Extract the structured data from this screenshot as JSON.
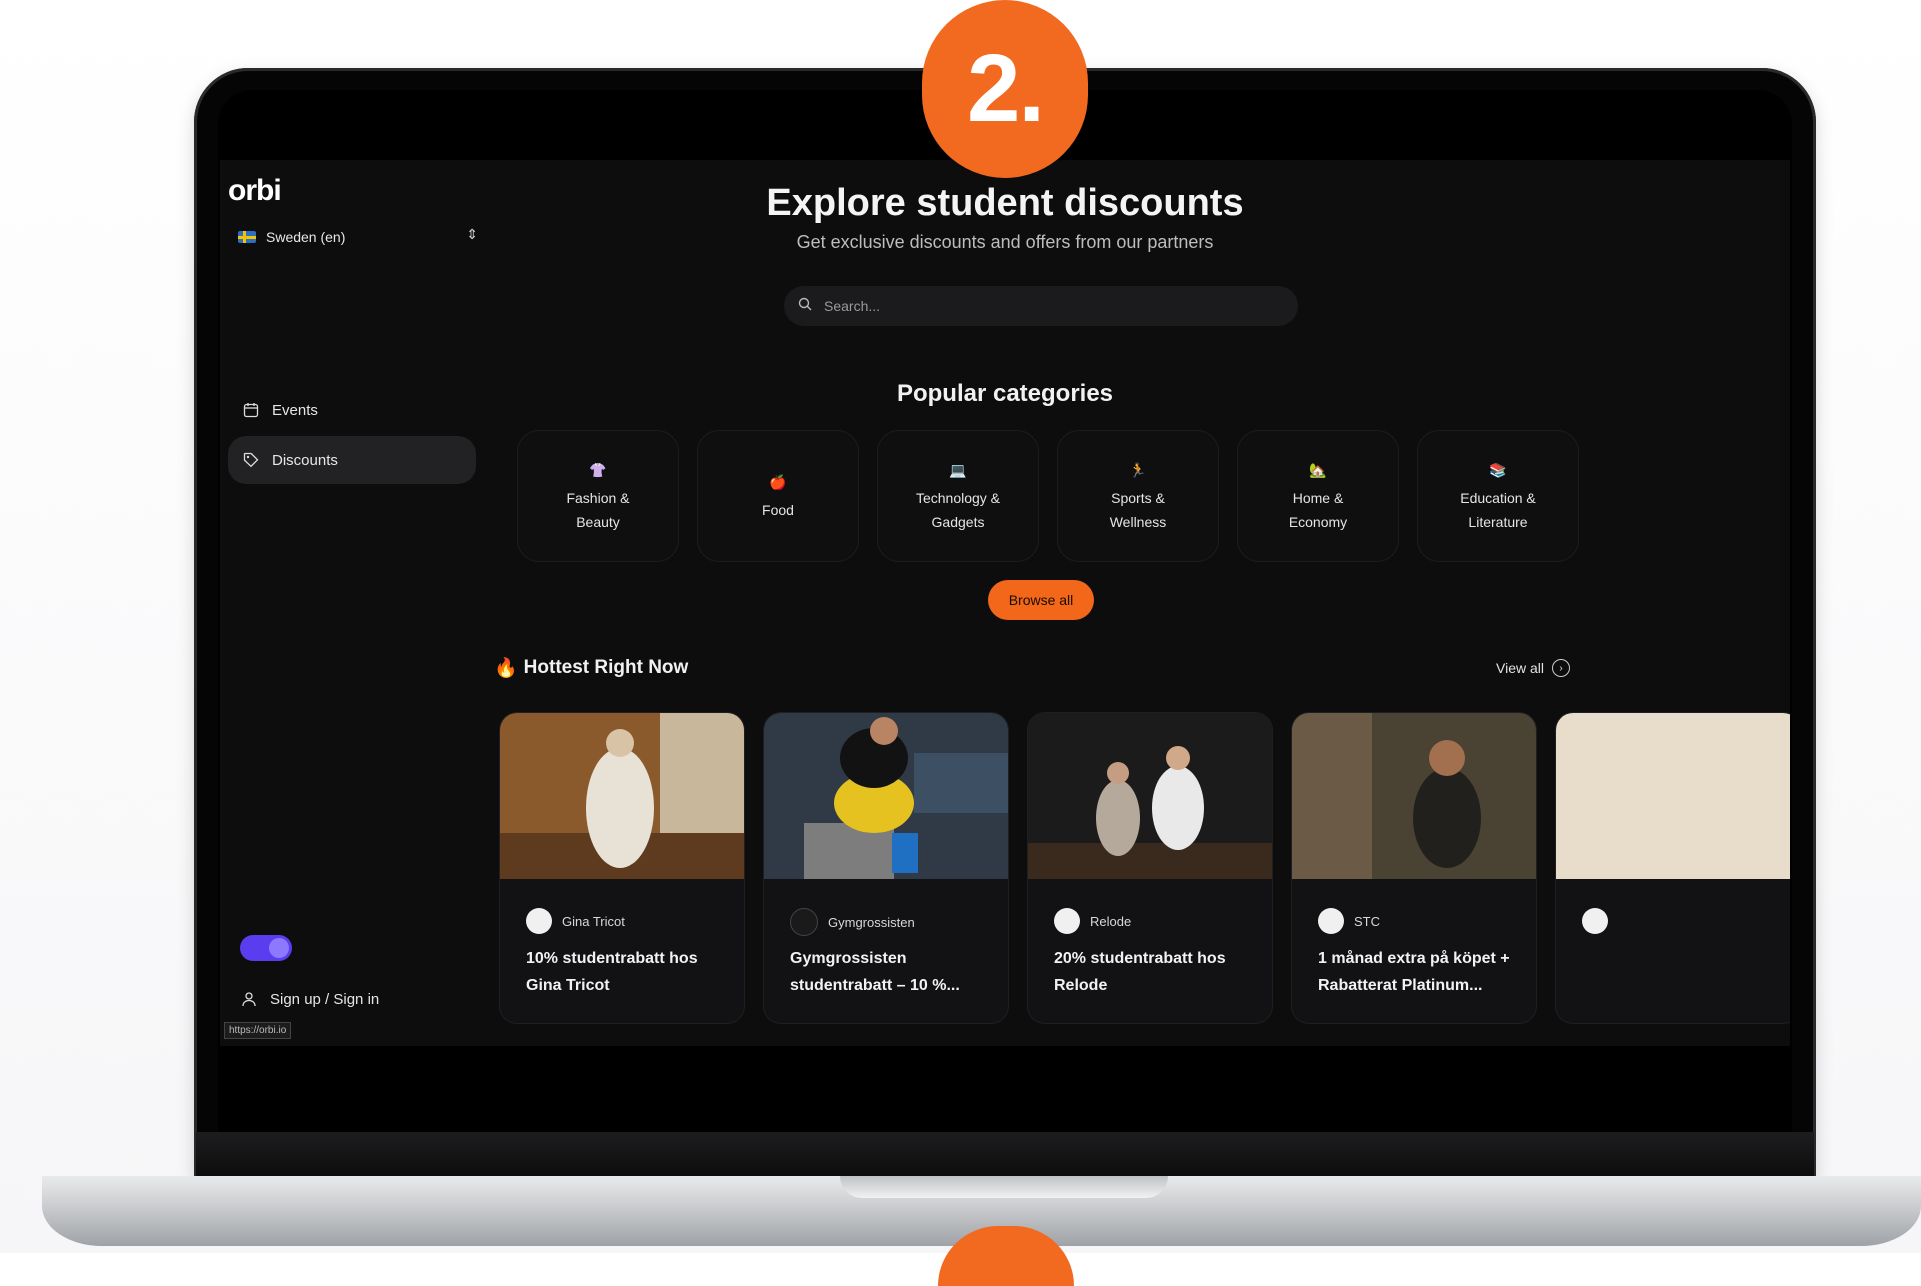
{
  "step_badge": "2.",
  "app": {
    "logo": "orbi"
  },
  "sidebar": {
    "language": "Sweden (en)",
    "items": [
      {
        "label": "Events",
        "icon": "calendar-icon"
      },
      {
        "label": "Discounts",
        "icon": "tag-icon",
        "active": true
      }
    ],
    "signin": "Sign up / Sign in",
    "url_hint": "https://orbi.io"
  },
  "header": {
    "title": "Explore student discounts",
    "subtitle": "Get exclusive discounts and offers from our partners"
  },
  "search": {
    "placeholder": "Search..."
  },
  "categories": {
    "title": "Popular categories",
    "items": [
      {
        "line1": "Fashion &",
        "line2": "Beauty",
        "emoji": "👚"
      },
      {
        "line1": "Food",
        "line2": "",
        "emoji": "🍎"
      },
      {
        "line1": "Technology &",
        "line2": "Gadgets",
        "emoji": "💻"
      },
      {
        "line1": "Sports &",
        "line2": "Wellness",
        "emoji": "🏃"
      },
      {
        "line1": "Home &",
        "line2": "Economy",
        "emoji": "🏡"
      },
      {
        "line1": "Education &",
        "line2": "Literature",
        "emoji": "📚"
      }
    ],
    "browse_label": "Browse all"
  },
  "hottest": {
    "title": "Hottest Right Now",
    "view_all": "View all",
    "cards": [
      {
        "brand": "Gina Tricot",
        "title": "10% studentrabatt hos Gina Tricot"
      },
      {
        "brand": "Gymgrossisten",
        "title": "Gymgrossisten studentrabatt – 10 %..."
      },
      {
        "brand": "Relode",
        "title": "20% studentrabatt hos Relode"
      },
      {
        "brand": "STC",
        "title": "1 månad extra på köpet + Rabatterat Platinum..."
      }
    ]
  },
  "colors": {
    "accent": "#f2671a",
    "toggle": "#5b3df0",
    "background": "#0d0d0e"
  }
}
